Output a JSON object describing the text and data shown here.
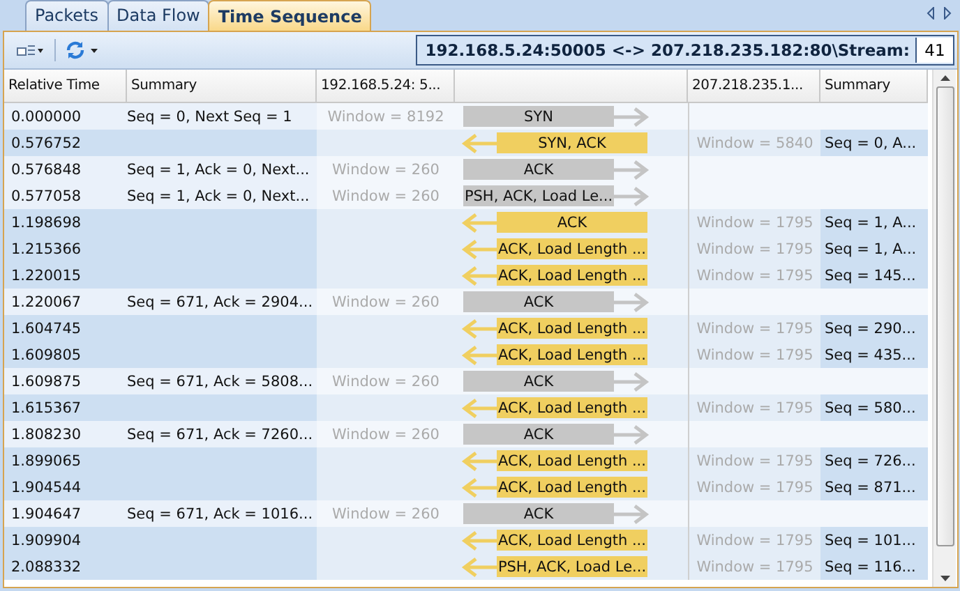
{
  "tabs": [
    {
      "label": "Packets",
      "selected": false
    },
    {
      "label": "Data Flow",
      "selected": false
    },
    {
      "label": "Time Sequence",
      "selected": true
    }
  ],
  "stream": {
    "path": "192.168.5.24:50005 <-> 207.218.235.182:80\\Stream:",
    "value": "41"
  },
  "table": {
    "columns": [
      "Relative Time",
      "Summary",
      "192.168.5.24: 5...",
      "207.218.235.1...",
      "Summary"
    ],
    "rows": [
      {
        "kind": "out",
        "time": "0.000000",
        "client_summary": "Seq = 0, Next Seq = 1",
        "client_window": "Window = 8192",
        "flags": "SYN"
      },
      {
        "kind": "in",
        "time": "0.576752",
        "flags": "SYN, ACK",
        "server_window": "Window = 5840",
        "server_summary": "Seq = 0, A..."
      },
      {
        "kind": "out",
        "time": "0.576848",
        "client_summary": "Seq = 1, Ack = 0, Next...",
        "client_window": "Window = 260",
        "flags": "ACK"
      },
      {
        "kind": "out",
        "time": "0.577058",
        "client_summary": "Seq = 1, Ack = 0, Next...",
        "client_window": "Window = 260",
        "flags": "PSH, ACK, Load Le..."
      },
      {
        "kind": "in",
        "time": "1.198698",
        "flags": "ACK",
        "server_window": "Window = 1795",
        "server_summary": "Seq = 1, A..."
      },
      {
        "kind": "in",
        "time": "1.215366",
        "flags": "ACK, Load Length ...",
        "server_window": "Window = 1795",
        "server_summary": "Seq = 1, A..."
      },
      {
        "kind": "in",
        "time": "1.220015",
        "flags": "ACK, Load Length ...",
        "server_window": "Window = 1795",
        "server_summary": "Seq = 145..."
      },
      {
        "kind": "out",
        "time": "1.220067",
        "client_summary": "Seq = 671, Ack = 2904...",
        "client_window": "Window = 260",
        "flags": "ACK"
      },
      {
        "kind": "in",
        "time": "1.604745",
        "flags": "ACK, Load Length ...",
        "server_window": "Window = 1795",
        "server_summary": "Seq = 290..."
      },
      {
        "kind": "in",
        "time": "1.609805",
        "flags": "ACK, Load Length ...",
        "server_window": "Window = 1795",
        "server_summary": "Seq = 435..."
      },
      {
        "kind": "out",
        "time": "1.609875",
        "client_summary": "Seq = 671, Ack = 5808...",
        "client_window": "Window = 260",
        "flags": "ACK"
      },
      {
        "kind": "in",
        "time": "1.615367",
        "flags": "ACK, Load Length ...",
        "server_window": "Window = 1795",
        "server_summary": "Seq = 580..."
      },
      {
        "kind": "out",
        "time": "1.808230",
        "client_summary": "Seq = 671, Ack = 7260...",
        "client_window": "Window = 260",
        "flags": "ACK"
      },
      {
        "kind": "in",
        "time": "1.899065",
        "flags": "ACK, Load Length ...",
        "server_window": "Window = 1795",
        "server_summary": "Seq = 726..."
      },
      {
        "kind": "in",
        "time": "1.904544",
        "flags": "ACK, Load Length ...",
        "server_window": "Window = 1795",
        "server_summary": "Seq = 871..."
      },
      {
        "kind": "out",
        "time": "1.904647",
        "client_summary": "Seq = 671, Ack = 1016...",
        "client_window": "Window = 260",
        "flags": "ACK"
      },
      {
        "kind": "in",
        "time": "1.909904",
        "flags": "ACK, Load Length ...",
        "server_window": "Window = 1795",
        "server_summary": "Seq = 101..."
      },
      {
        "kind": "in",
        "time": "2.088332",
        "flags": "PSH, ACK, Load Le...",
        "server_window": "Window = 1795",
        "server_summary": "Seq = 116..."
      }
    ]
  }
}
